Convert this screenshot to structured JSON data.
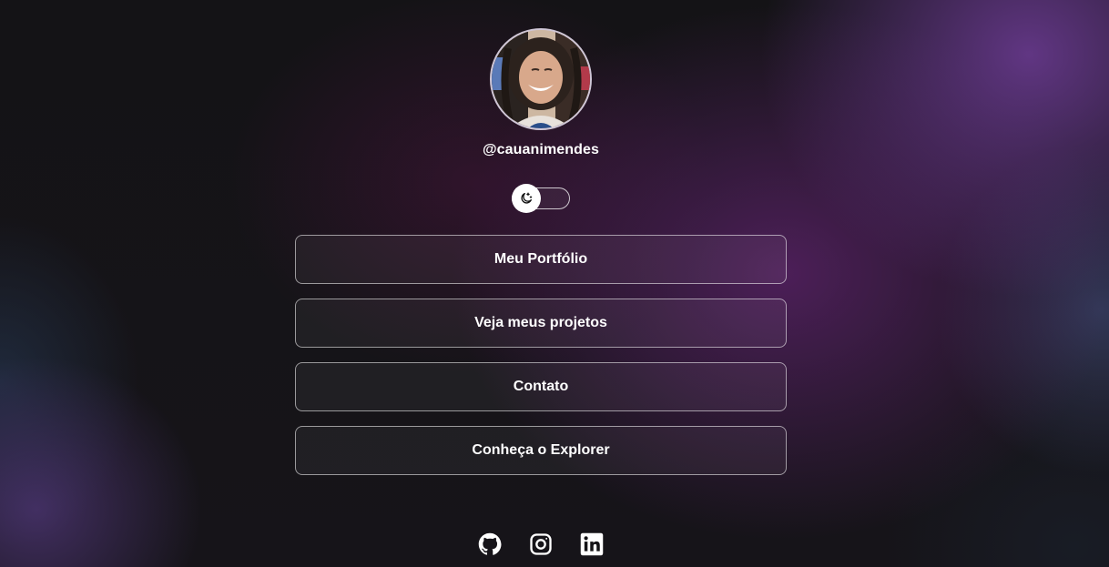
{
  "profile": {
    "username": "@cauanimendes",
    "avatar": "profile-photo"
  },
  "theme_toggle": {
    "icon": "moon-icon",
    "state": "dark"
  },
  "links": [
    {
      "label": "Meu Portfólio"
    },
    {
      "label": "Veja meus projetos"
    },
    {
      "label": "Contato"
    },
    {
      "label": "Conheça o Explorer"
    }
  ],
  "social": [
    {
      "icon": "github-icon"
    },
    {
      "icon": "instagram-icon"
    },
    {
      "icon": "linkedin-icon"
    }
  ],
  "colors": {
    "text": "#ffffff",
    "background": "#141316",
    "accent_purple": "#6e3c96"
  }
}
